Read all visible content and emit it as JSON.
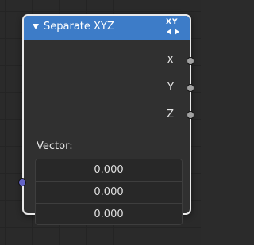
{
  "node": {
    "title": "Separate XYZ",
    "header_color": "#3d7cc8",
    "icon": "xy-direction-icon",
    "icon_text": "XY",
    "outputs": [
      {
        "label": "X",
        "socket_color": "#a1a1a1"
      },
      {
        "label": "Y",
        "socket_color": "#a1a1a1"
      },
      {
        "label": "Z",
        "socket_color": "#a1a1a1"
      }
    ],
    "input": {
      "label": "Vector:",
      "socket_color": "#6363c7",
      "values": [
        "0.000",
        "0.000",
        "0.000"
      ]
    }
  }
}
